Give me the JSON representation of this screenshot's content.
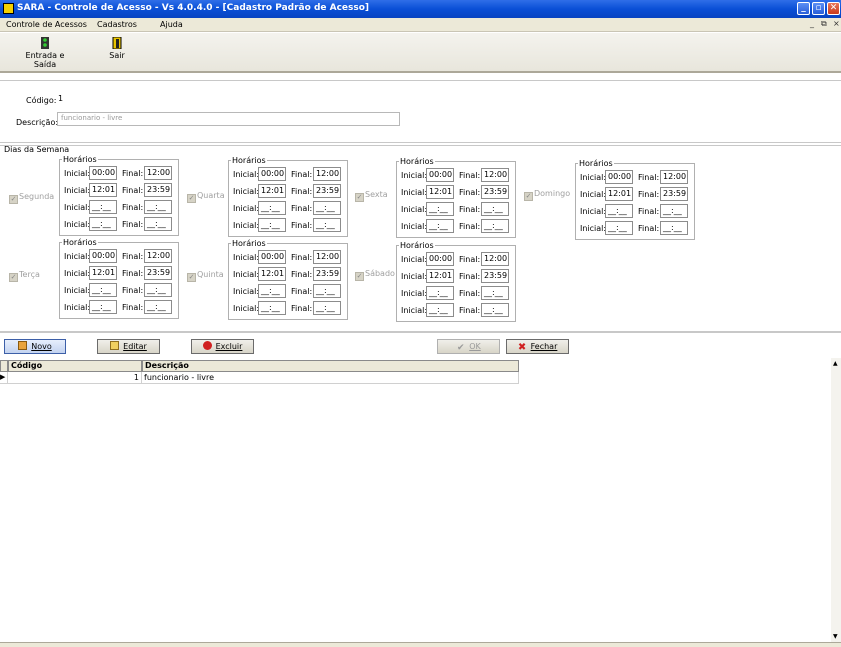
{
  "window": {
    "title": "SARA - Controle de Acesso - Vs 4.0.4.0 - [Cadastro Padrão de Acesso]"
  },
  "menu": {
    "items": [
      "Controle de Acessos",
      "Cadastros",
      "Ajuda"
    ]
  },
  "toolbar": {
    "entrada_label": "Entrada e Saída",
    "sair_label": "Sair"
  },
  "header": {
    "codigo_label": "Código:",
    "codigo_value": "1",
    "descricao_label": "Descrição:",
    "descricao_value": "funcionario - livre"
  },
  "dias": {
    "section_title": "Dias da Semana",
    "group_title": "Horários",
    "inicial_label": "Inicial:",
    "final_label": "Final:",
    "days": [
      {
        "name": "Segunda",
        "rows": [
          [
            "00:00",
            "12:00"
          ],
          [
            "12:01",
            "23:59"
          ],
          [
            "__:__",
            "__:__"
          ],
          [
            "__:__",
            "__:__"
          ]
        ]
      },
      {
        "name": "Terça",
        "rows": [
          [
            "00:00",
            "12:00"
          ],
          [
            "12:01",
            "23:59"
          ],
          [
            "__:__",
            "__:__"
          ],
          [
            "__:__",
            "__:__"
          ]
        ]
      },
      {
        "name": "Quarta",
        "rows": [
          [
            "00:00",
            "12:00"
          ],
          [
            "12:01",
            "23:59"
          ],
          [
            "__:__",
            "__:__"
          ],
          [
            "__:__",
            "__:__"
          ]
        ]
      },
      {
        "name": "Quinta",
        "rows": [
          [
            "00:00",
            "12:00"
          ],
          [
            "12:01",
            "23:59"
          ],
          [
            "__:__",
            "__:__"
          ],
          [
            "__:__",
            "__:__"
          ]
        ]
      },
      {
        "name": "Sexta",
        "rows": [
          [
            "00:00",
            "12:00"
          ],
          [
            "12:01",
            "23:59"
          ],
          [
            "__:__",
            "__:__"
          ],
          [
            "__:__",
            "__:__"
          ]
        ]
      },
      {
        "name": "Sábado",
        "rows": [
          [
            "00:00",
            "12:00"
          ],
          [
            "12:01",
            "23:59"
          ],
          [
            "__:__",
            "__:__"
          ],
          [
            "__:__",
            "__:__"
          ]
        ]
      },
      {
        "name": "Domingo",
        "rows": [
          [
            "00:00",
            "12:00"
          ],
          [
            "12:01",
            "23:59"
          ],
          [
            "__:__",
            "__:__"
          ],
          [
            "__:__",
            "__:__"
          ]
        ]
      }
    ]
  },
  "buttons": {
    "novo": "Novo",
    "editar": "Editar",
    "excluir": "Excluir",
    "ok": "OK",
    "fechar": "Fechar"
  },
  "grid": {
    "columns": [
      "Código",
      "Descrição"
    ],
    "rows": [
      {
        "codigo": "1",
        "descricao": "funcionario - livre"
      }
    ]
  }
}
